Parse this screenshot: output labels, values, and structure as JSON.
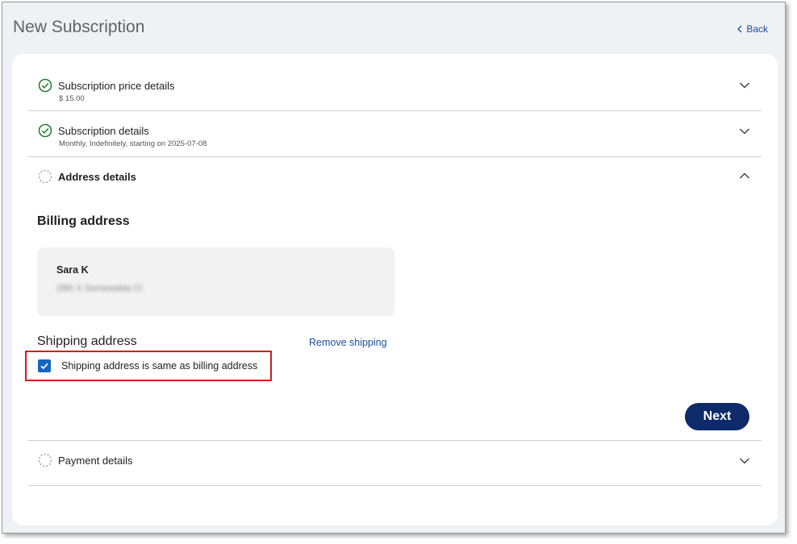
{
  "header": {
    "title": "New Subscription",
    "back_label": "Back"
  },
  "steps": [
    {
      "title": "Subscription price details",
      "subtitle": "$ 15.00",
      "status": "complete",
      "expanded": false
    },
    {
      "title": "Subscription details",
      "subtitle": "Monthly, Indefinitely, starting on 2025-07-08",
      "status": "complete",
      "expanded": false
    },
    {
      "title": "Address details",
      "subtitle": "",
      "status": "in-progress",
      "expanded": true
    },
    {
      "title": "Payment details",
      "subtitle": "",
      "status": "pending",
      "expanded": false
    }
  ],
  "address": {
    "billing_heading": "Billing address",
    "billing_name": "Sara K",
    "billing_line": "28th X Somewalda Ct",
    "shipping_heading": "Shipping address",
    "remove_shipping_label": "Remove shipping",
    "same_as_billing_label": "Shipping address is same as billing address",
    "same_as_billing_checked": true,
    "next_label": "Next"
  },
  "colors": {
    "complete_green": "#2e7d32",
    "link_blue": "#1a4fa0",
    "primary_button": "#0d2a6b",
    "checkbox_blue": "#1565c0",
    "highlight_red": "#d9191c"
  },
  "icons": {
    "complete": "check-circle-icon",
    "pending": "dashed-circle-icon",
    "back": "chevron-left-icon",
    "expand": "chevron-down-icon",
    "collapse": "chevron-up-icon"
  }
}
